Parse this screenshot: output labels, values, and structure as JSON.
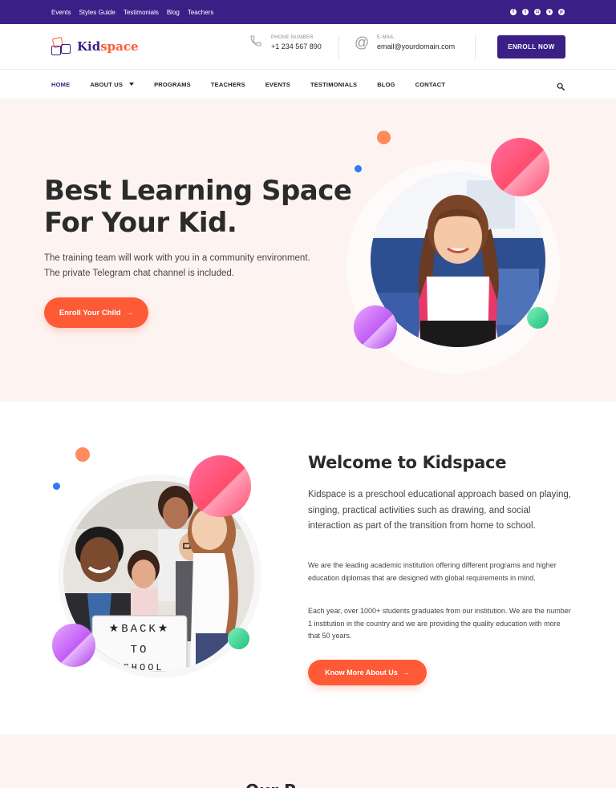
{
  "topbar": {
    "links": [
      "Events",
      "Styles Guide",
      "Testimonials",
      "Blog",
      "Teachers"
    ],
    "social_icons": [
      "facebook-icon",
      "twitter-icon",
      "instagram-icon",
      "skype-icon",
      "pinterest-icon"
    ]
  },
  "header": {
    "logo_part1": "Kid",
    "logo_part2": "space",
    "phone_label": "PHONE NUMBER",
    "phone_value": "+1 234 567 890",
    "email_label": "E-MAIL",
    "email_value": "email@yourdomain.com",
    "enroll_label": "ENROLL NOW"
  },
  "nav": {
    "items": [
      "HOME",
      "ABOUT US",
      "PROGRAMS",
      "TEACHERS",
      "EVENTS",
      "TESTIMONIALS",
      "BLOG",
      "CONTACT"
    ]
  },
  "hero": {
    "title_line1": "Best Learning Space",
    "title_line2": "For Your Kid.",
    "description_line1": "The training team will work with you in a community environment.",
    "description_line2": "The private Telegram chat channel is included.",
    "cta_label": "Enroll Your Child"
  },
  "about": {
    "title": "Welcome to Kidspace",
    "lead": "Kidspace is a preschool educational approach based on playing, singing, practical activities such as drawing, and social interaction as part of the transition from home to school.",
    "paragraph2": "We are the leading academic institution offering different programs and higher education diplomas that are designed with global requirements in mind.",
    "paragraph3": "Each year, over 1000+ students graduates from our institution. We are the number 1 institution in the country and we are providing the quality education with more that 50 years.",
    "cta_label": "Know More About Us",
    "sign_text": "BACK TO SCHOOL"
  },
  "bottom": {
    "heading_peek": "Our P"
  },
  "colors": {
    "brand_purple": "#3b1f87",
    "accent_orange": "#ff5a36",
    "hero_bg": "#fdf4f2"
  }
}
